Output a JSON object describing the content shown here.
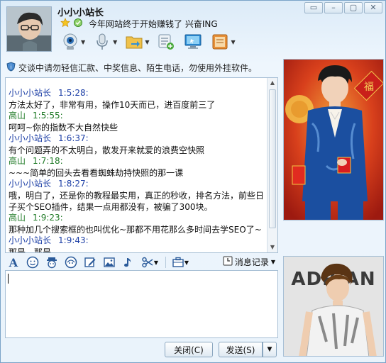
{
  "window": {
    "controls": [
      "▭",
      "–",
      "▢",
      "✕"
    ]
  },
  "contact": {
    "name": "小小小站长",
    "signature": "今年网站终于开始赚钱了 兴奋ING"
  },
  "notice": "交谈中请勿轻信汇款、中奖信息、陌生电话，勿使用外挂软件。",
  "messages": [
    {
      "sender": "小小小站长",
      "time": "1:5:28:",
      "text": "方法太好了，非常有用，操作10天而已，进百度前三了",
      "self": true
    },
    {
      "sender": "高山",
      "time": "1:5:55:",
      "text": "呵呵~你的指数不大自然快些",
      "self": false
    },
    {
      "sender": "小小小站长",
      "time": "1:6:37:",
      "text": "有个问题弄的不太明白，散发开来就爱的浪费空快照",
      "self": true
    },
    {
      "sender": "高山",
      "time": "1:7:18:",
      "text": "~~~简单的回头去看看蜘蛛劫持快照的那一课",
      "self": false
    },
    {
      "sender": "小小小站长",
      "time": "1:8:27:",
      "text": "哦，明白了，还是你的教程最实用，真正的秒收，排名方法，前些日子买个SEO插件，结果一点用都没有，被骗了300块。",
      "self": true
    },
    {
      "sender": "高山",
      "time": "1:9:23:",
      "text": "那种加几个搜索框的也叫优化~那都不用花那么多时间去学SEO了~",
      "self": false
    },
    {
      "sender": "小小小站长",
      "time": "1:9:43:",
      "text": "那是，那是",
      "self": true
    }
  ],
  "format_bar": {
    "history_label": "消息记录"
  },
  "buttons": {
    "close": "关闭(C)",
    "send": "发送(S)",
    "send_dropdown": "▼"
  },
  "images": {
    "top_banner_text": "",
    "bottom_banner_text": "ADRIAN"
  }
}
